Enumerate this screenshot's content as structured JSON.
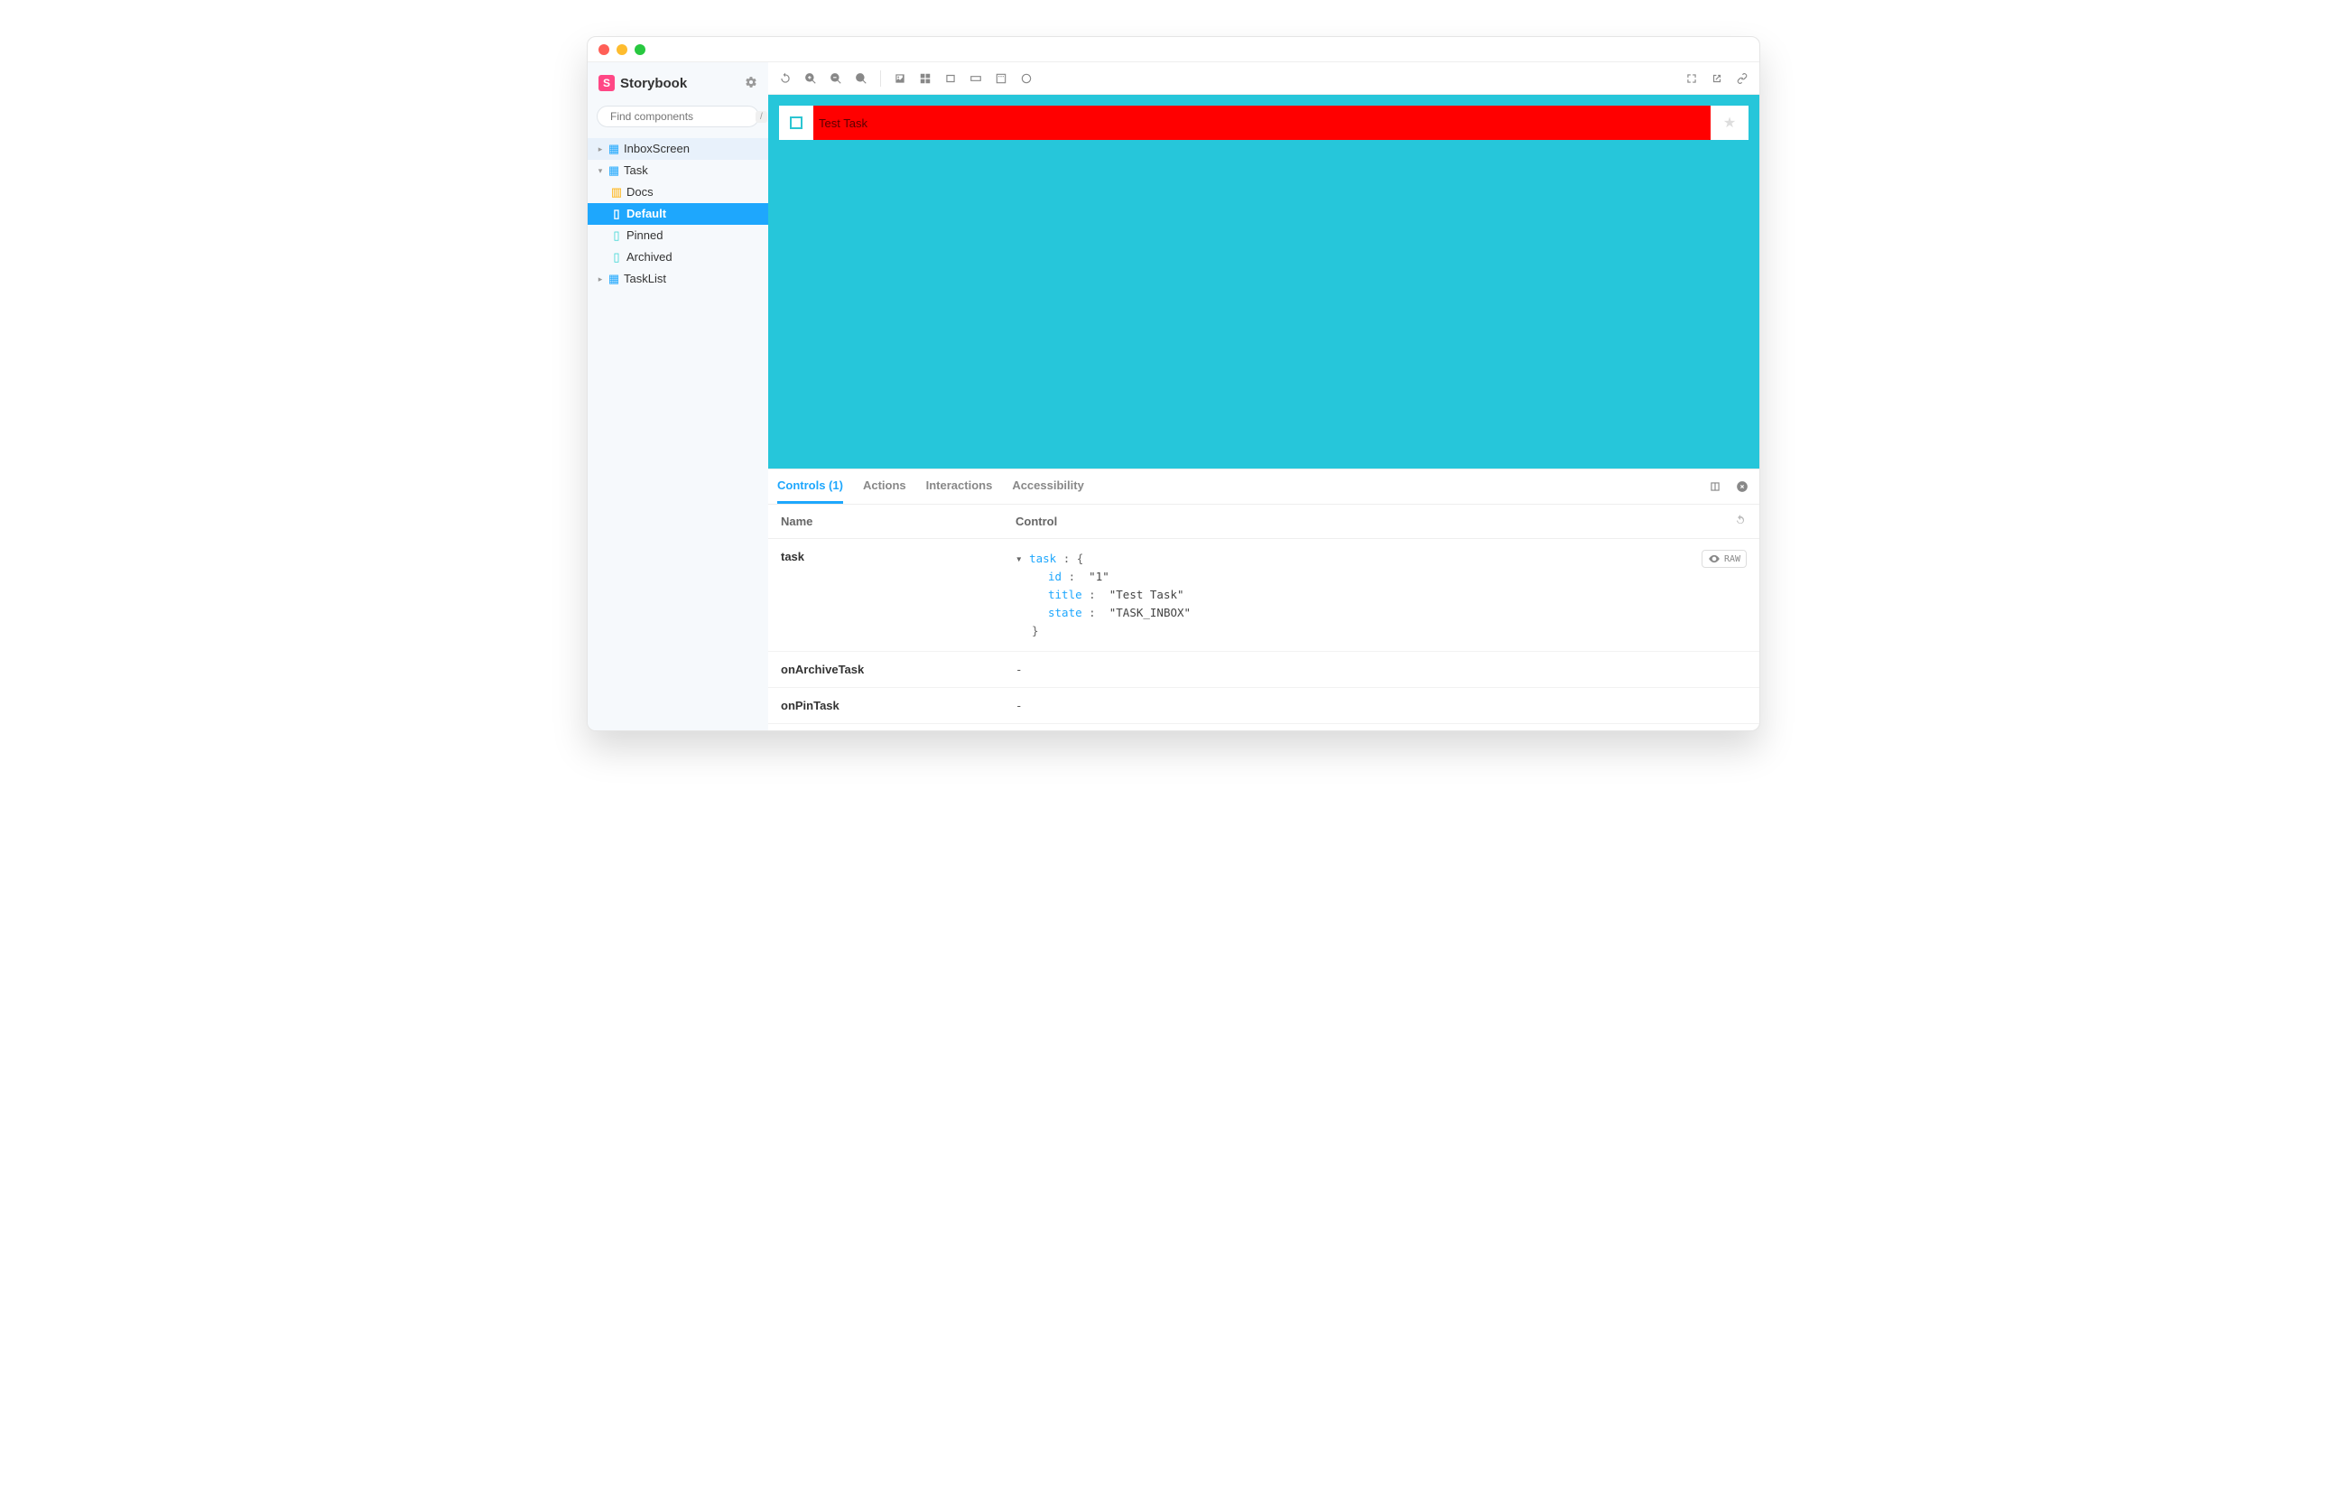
{
  "app": {
    "name": "Storybook"
  },
  "search": {
    "placeholder": "Find components",
    "shortcut": "/"
  },
  "tree": {
    "inbox": "InboxScreen",
    "task": "Task",
    "task_docs": "Docs",
    "task_default": "Default",
    "task_pinned": "Pinned",
    "task_archived": "Archived",
    "tasklist": "TaskList"
  },
  "canvas": {
    "task_title": "Test Task"
  },
  "addons": {
    "tabs": {
      "controls": "Controls (1)",
      "actions": "Actions",
      "interactions": "Interactions",
      "accessibility": "Accessibility"
    },
    "head": {
      "name": "Name",
      "control": "Control"
    },
    "raw_label": "RAW",
    "rows": {
      "task": {
        "name": "task",
        "obj_label": "task",
        "id_key": "id",
        "id_val": "\"1\"",
        "title_key": "title",
        "title_val": "\"Test Task\"",
        "state_key": "state",
        "state_val": "\"TASK_INBOX\""
      },
      "onArchive": {
        "name": "onArchiveTask",
        "val": "-"
      },
      "onPin": {
        "name": "onPinTask",
        "val": "-"
      }
    }
  }
}
